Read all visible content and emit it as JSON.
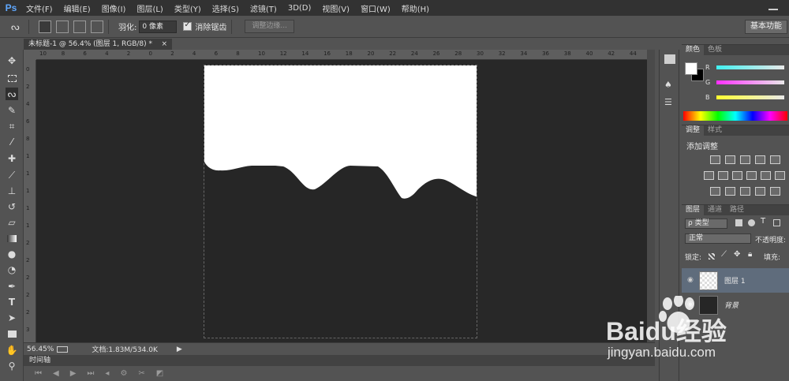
{
  "app": {
    "logo": "Ps"
  },
  "menu": [
    "文件(F)",
    "编辑(E)",
    "图像(I)",
    "图层(L)",
    "类型(Y)",
    "选择(S)",
    "滤镜(T)",
    "3D(D)",
    "视图(V)",
    "窗口(W)",
    "帮助(H)"
  ],
  "options": {
    "feather_label": "羽化:",
    "feather_value": "0 像素",
    "antialias_label": "消除锯齿",
    "refine_edge_label": "调整边缘...",
    "workspace_label": "基本功能"
  },
  "document": {
    "tab_title": "未标题-1 @ 56.4% (图层 1, RGB/8) *",
    "close": "×"
  },
  "ruler": {
    "top_ticks": [
      "10",
      "8",
      "6",
      "4",
      "2",
      "0",
      "2",
      "4",
      "6",
      "8",
      "10",
      "12",
      "14",
      "16",
      "18",
      "20",
      "22",
      "24",
      "26",
      "28",
      "30",
      "32",
      "34",
      "36",
      "38",
      "40",
      "42",
      "44"
    ],
    "left_ticks": [
      "0",
      "2",
      "4",
      "6",
      "8",
      "1",
      "1",
      "1",
      "1",
      "1",
      "2",
      "2",
      "2",
      "2",
      "2",
      "3"
    ]
  },
  "status": {
    "zoom": "56.45%",
    "doc_info": "文档:1.83M/534.0K"
  },
  "timeline": {
    "label": "时间轴"
  },
  "color_panel": {
    "tabs": [
      "颜色",
      "色板"
    ],
    "r_label": "R",
    "g_label": "G",
    "b_label": "B",
    "colors": {
      "r": "#ff3030",
      "g": "#e020e0",
      "b": "#ffff20"
    }
  },
  "adjust_panel": {
    "tabs": [
      "调整",
      "样式"
    ],
    "title": "添加调整"
  },
  "layers_panel": {
    "tabs": [
      "图层",
      "通道",
      "路径"
    ],
    "filter_label": "ρ 类型",
    "blend_mode": "正常",
    "opacity_label": "不透明度:",
    "lock_label": "锁定:",
    "fill_label": "填充:",
    "layers": [
      {
        "name": "图层 1",
        "selected": true
      },
      {
        "name": "背景",
        "selected": false
      }
    ]
  },
  "watermark": {
    "brand": "Baidu经验",
    "url": "jingyan.baidu.com"
  }
}
